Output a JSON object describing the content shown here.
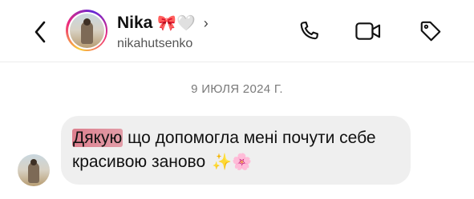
{
  "header": {
    "contact_name": "Nika",
    "name_emojis": "🎀🤍",
    "chevron": "›",
    "username": "nikahutsenko",
    "icons": [
      "back-chevron-icon",
      "phone-icon",
      "video-camera-icon",
      "tag-icon"
    ]
  },
  "thread": {
    "date_label": "9 ИЮЛЯ 2024 Г.",
    "messages": [
      {
        "highlighted_text": "Дякую",
        "text_rest": " що допомогла мені почути себе красивою заново",
        "emojis": "✨🌸"
      }
    ]
  },
  "colors": {
    "bubble": "#efefef",
    "highlight": "#d75a6e",
    "story_ring": [
      "#f9ce34",
      "#ee2a7b",
      "#6228d7"
    ]
  }
}
